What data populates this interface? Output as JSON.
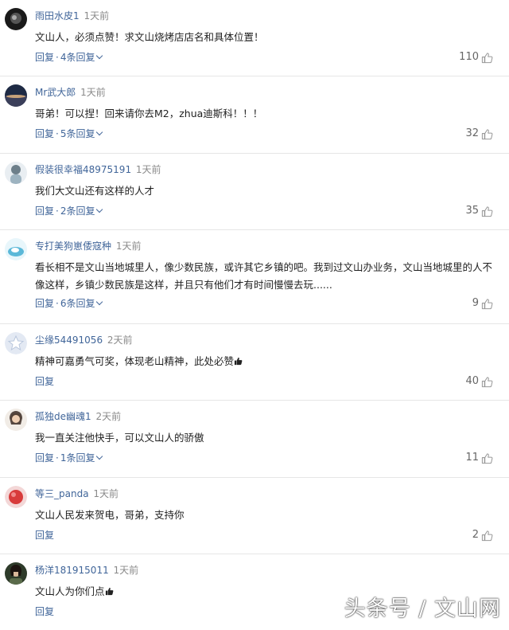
{
  "comments": [
    {
      "username": "雨田水皮1",
      "time": "1天前",
      "text": "文山人，必须点赞！求文山烧烤店店名和具体位置！",
      "reply_label": "回复",
      "replies_label": "4条回复",
      "likes": "110",
      "has_emoji": false
    },
    {
      "username": "Mr武大郎",
      "time": "1天前",
      "text": "哥弟！可以捏！回来请你去M2，zhua迪斯科！！！",
      "reply_label": "回复",
      "replies_label": "5条回复",
      "likes": "32",
      "has_emoji": false
    },
    {
      "username": "假装很幸福48975191",
      "time": "1天前",
      "text": "我们大文山还有这样的人才",
      "reply_label": "回复",
      "replies_label": "2条回复",
      "likes": "35",
      "has_emoji": false
    },
    {
      "username": "专打美狗崽倭寇种",
      "time": "1天前",
      "text": "看长相不是文山当地城里人，像少数民族，或许其它乡镇的吧。我到过文山办业务，文山当地城里的人不像这样，乡镇少数民族是这样，并且只有他们才有时间慢慢去玩......",
      "reply_label": "回复",
      "replies_label": "6条回复",
      "likes": "9",
      "has_emoji": false
    },
    {
      "username": "尘缘54491056",
      "time": "2天前",
      "text": "精神可嘉勇气可奖，体现老山精神，此处必赞",
      "reply_label": "回复",
      "replies_label": "",
      "likes": "40",
      "has_emoji": true
    },
    {
      "username": "孤独de幽魂1",
      "time": "2天前",
      "text": "我一直关注他快手，可以文山人的骄傲",
      "reply_label": "回复",
      "replies_label": "1条回复",
      "likes": "11",
      "has_emoji": false
    },
    {
      "username": "等三_panda",
      "time": "1天前",
      "text": "文山人民发来贺电，哥弟，支持你",
      "reply_label": "回复",
      "replies_label": "",
      "likes": "2",
      "has_emoji": false
    },
    {
      "username": "杨洋181915011",
      "time": "1天前",
      "text": "文山人为你们点",
      "reply_label": "回复",
      "replies_label": "",
      "likes": "",
      "has_emoji": true
    }
  ],
  "watermark": "头条号 / 文山网",
  "colors": {
    "link": "#406599",
    "time": "#8a8a8a",
    "divider": "#e6e6e6"
  }
}
